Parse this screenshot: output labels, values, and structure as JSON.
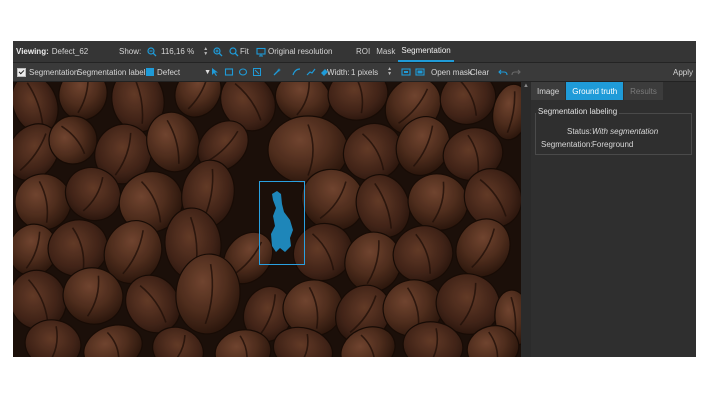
{
  "viewer": {
    "viewing_label": "Viewing:",
    "viewing_value": "Defect_62",
    "show_label": "Show:",
    "zoom_value": "116,16 %",
    "fit_label": "Fit",
    "original_label": "Original resolution",
    "tabs": [
      {
        "label": "ROI",
        "active": false
      },
      {
        "label": "Mask",
        "active": false
      },
      {
        "label": "Segmentation",
        "active": true
      }
    ]
  },
  "seg_toolbar": {
    "segmentation_label": "Segmentation",
    "segmentation_checked": true,
    "labels_label": "Segmentation labels:",
    "label_value": "Defect",
    "label_color": "#1f9bd8",
    "width_label": "Width:",
    "width_value": "1 pixels",
    "open_mask": "Open mask",
    "clear": "Clear",
    "apply": "Apply",
    "tool_icons": [
      "select-arrow-icon",
      "rectangle-icon",
      "ellipse-icon",
      "move-icon",
      "magic-wand-icon",
      "freehand-curve-icon",
      "freehand-line-icon",
      "eraser-icon"
    ],
    "undo_icon": "undo-icon",
    "redo_icon": "redo-icon"
  },
  "right_panel": {
    "tabs": [
      {
        "label": "Image",
        "state": "normal"
      },
      {
        "label": "Ground truth",
        "state": "active"
      },
      {
        "label": "Results",
        "state": "disabled"
      }
    ],
    "group_title": "Segmentation labeling",
    "status_label": "Status:",
    "status_value": "With segmentation",
    "seg_label": "Segmentation:",
    "seg_value": "Foreground"
  },
  "image": {
    "subject": "coffee beans",
    "annotation_color": "#1f9bd8"
  }
}
